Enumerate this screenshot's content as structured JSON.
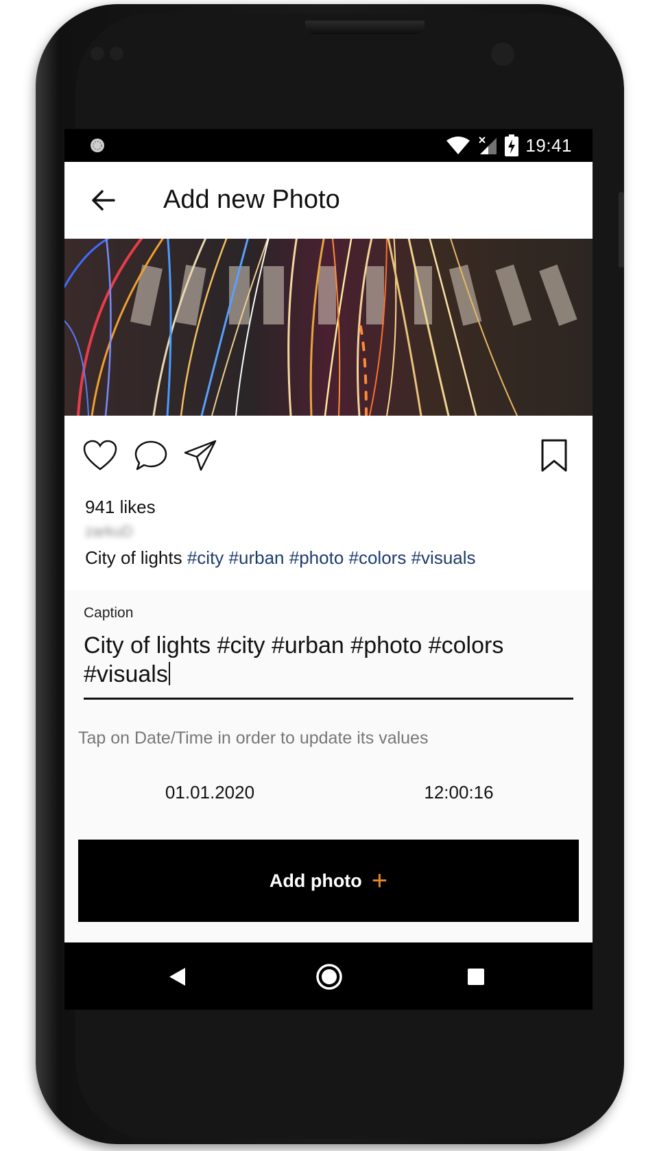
{
  "status_bar": {
    "time": "19:41",
    "icons": [
      "sync-icon",
      "wifi-icon",
      "signal-icon",
      "battery-charging-icon"
    ]
  },
  "app_bar": {
    "title": "Add new Photo",
    "back_icon": "arrow-left-icon"
  },
  "post": {
    "actions": [
      "heart-icon",
      "comment-icon",
      "send-icon",
      "bookmark-icon"
    ],
    "likes": "941 likes",
    "username": "zarkuD",
    "caption_text": "City of lights",
    "hashtags": [
      "#city",
      "#urban",
      "#photo",
      "#colors",
      "#visuals"
    ]
  },
  "form": {
    "caption_label": "Caption",
    "caption_value": "City of lights #city #urban #photo #colors #visuals",
    "hint": "Tap on Date/Time in order to update its values",
    "date": "01.01.2020",
    "time": "12:00:16",
    "submit_label": "Add photo",
    "submit_icon": "+"
  },
  "nav_bar": {
    "buttons": [
      "back-triangle-icon",
      "home-circle-icon",
      "recents-square-icon"
    ]
  },
  "colors": {
    "hashtag": "#1d3c6e",
    "accent_plus": "#e8872c",
    "screen_bg": "#fafafa",
    "bars": "#000000"
  }
}
